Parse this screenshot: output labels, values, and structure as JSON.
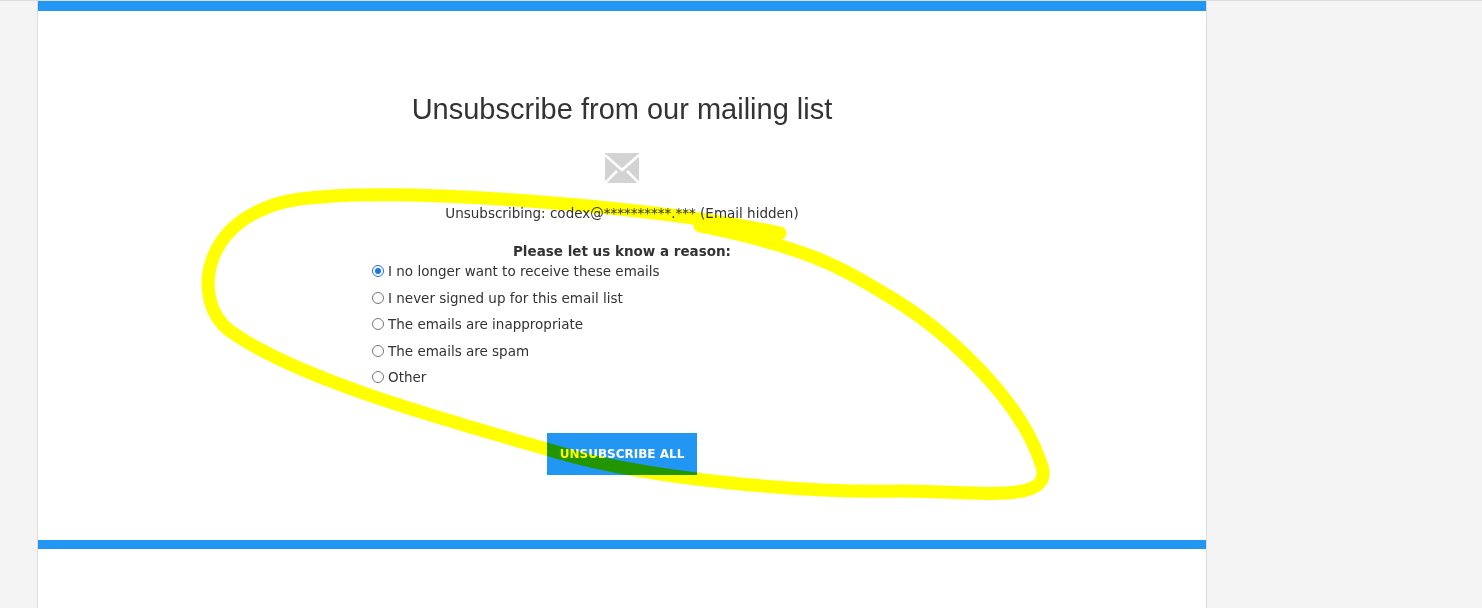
{
  "title": "Unsubscribe from our mailing list",
  "email_line": "Unsubscribing: codex@**********.*** (Email hidden)",
  "reason_prompt": "Please let us know a reason:",
  "reasons": [
    {
      "label": "I no longer want to receive these emails",
      "selected": true
    },
    {
      "label": "I never signed up for this email list",
      "selected": false
    },
    {
      "label": "The emails are inappropriate",
      "selected": false
    },
    {
      "label": "The emails are spam",
      "selected": false
    },
    {
      "label": "Other",
      "selected": false
    }
  ],
  "button": "UNSUBSCRIBE ALL"
}
